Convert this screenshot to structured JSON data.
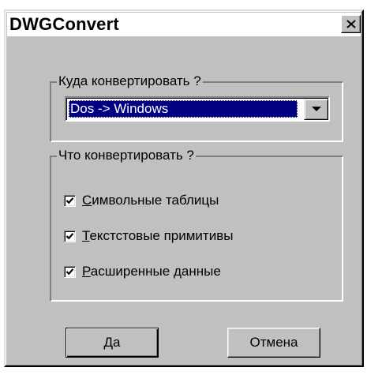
{
  "window": {
    "title": "DWGConvert",
    "close_icon": "close-icon"
  },
  "direction_group": {
    "caption": "Куда конвертировать ?",
    "selected_option": "Dos -> Windows",
    "dropdown_icon": "chevron-down-icon"
  },
  "what_group": {
    "caption": "Что конвертировать ?",
    "items": [
      {
        "mnemonic": "С",
        "rest": "имвольные таблицы",
        "checked": true
      },
      {
        "mnemonic": "Т",
        "rest": "екстстовые примитивы",
        "checked": true
      },
      {
        "mnemonic": "Р",
        "rest": "асширенные данные",
        "checked": true
      }
    ]
  },
  "buttons": {
    "ok_label": "Да",
    "cancel_label": "Отмена"
  },
  "colors": {
    "face": "#c0c0c0",
    "selection": "#000080"
  }
}
